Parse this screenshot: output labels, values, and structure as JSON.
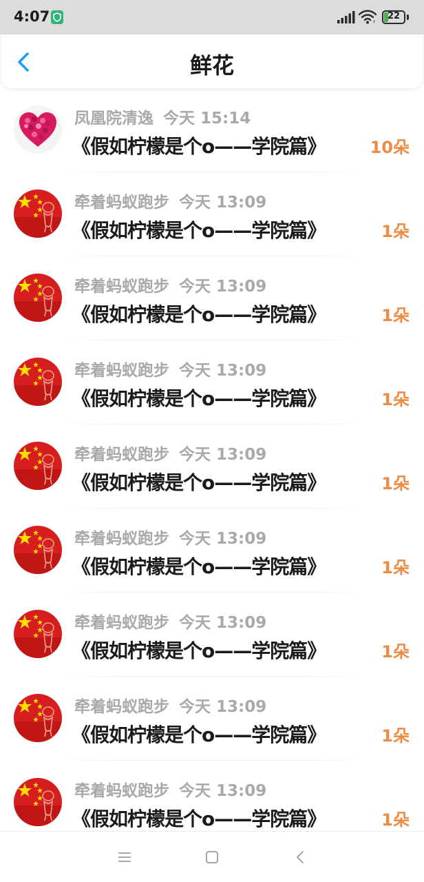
{
  "status_bar": {
    "time": "4:07",
    "battery_level": "22",
    "battery_fraction": 0.22,
    "icons": [
      "shield-icon",
      "signal-icon",
      "wifi-icon",
      "battery-icon"
    ]
  },
  "header": {
    "title": "鲜花",
    "back_icon": "chevron-left-icon"
  },
  "colors": {
    "accent_blue": "#1a9bf0",
    "count_orange": "#f08a42",
    "username_gray": "#a9a9a9",
    "battery_green": "#4caf50"
  },
  "rows": [
    {
      "user": "凤凰院清逸",
      "time": "今天 15:14",
      "title": "《假如柠檬是个o——学院篇》",
      "count": "10朵",
      "avatar": "heart-avatar"
    },
    {
      "user": "牵着蚂蚁跑步",
      "time": "今天 13:09",
      "title": "《假如柠檬是个o——学院篇》",
      "count": "1朵",
      "avatar": "flag-avatar"
    },
    {
      "user": "牵着蚂蚁跑步",
      "time": "今天 13:09",
      "title": "《假如柠檬是个o——学院篇》",
      "count": "1朵",
      "avatar": "flag-avatar"
    },
    {
      "user": "牵着蚂蚁跑步",
      "time": "今天 13:09",
      "title": "《假如柠檬是个o——学院篇》",
      "count": "1朵",
      "avatar": "flag-avatar"
    },
    {
      "user": "牵着蚂蚁跑步",
      "time": "今天 13:09",
      "title": "《假如柠檬是个o——学院篇》",
      "count": "1朵",
      "avatar": "flag-avatar"
    },
    {
      "user": "牵着蚂蚁跑步",
      "time": "今天 13:09",
      "title": "《假如柠檬是个o——学院篇》",
      "count": "1朵",
      "avatar": "flag-avatar"
    },
    {
      "user": "牵着蚂蚁跑步",
      "time": "今天 13:09",
      "title": "《假如柠檬是个o——学院篇》",
      "count": "1朵",
      "avatar": "flag-avatar"
    },
    {
      "user": "牵着蚂蚁跑步",
      "time": "今天 13:09",
      "title": "《假如柠檬是个o——学院篇》",
      "count": "1朵",
      "avatar": "flag-avatar"
    },
    {
      "user": "牵着蚂蚁跑步",
      "time": "今天 13:09",
      "title": "《假如柠檬是个o——学院篇》",
      "count": "1朵",
      "avatar": "flag-avatar"
    }
  ],
  "nav_bar": {
    "buttons": [
      "menu-icon",
      "home-icon",
      "back-icon"
    ]
  }
}
